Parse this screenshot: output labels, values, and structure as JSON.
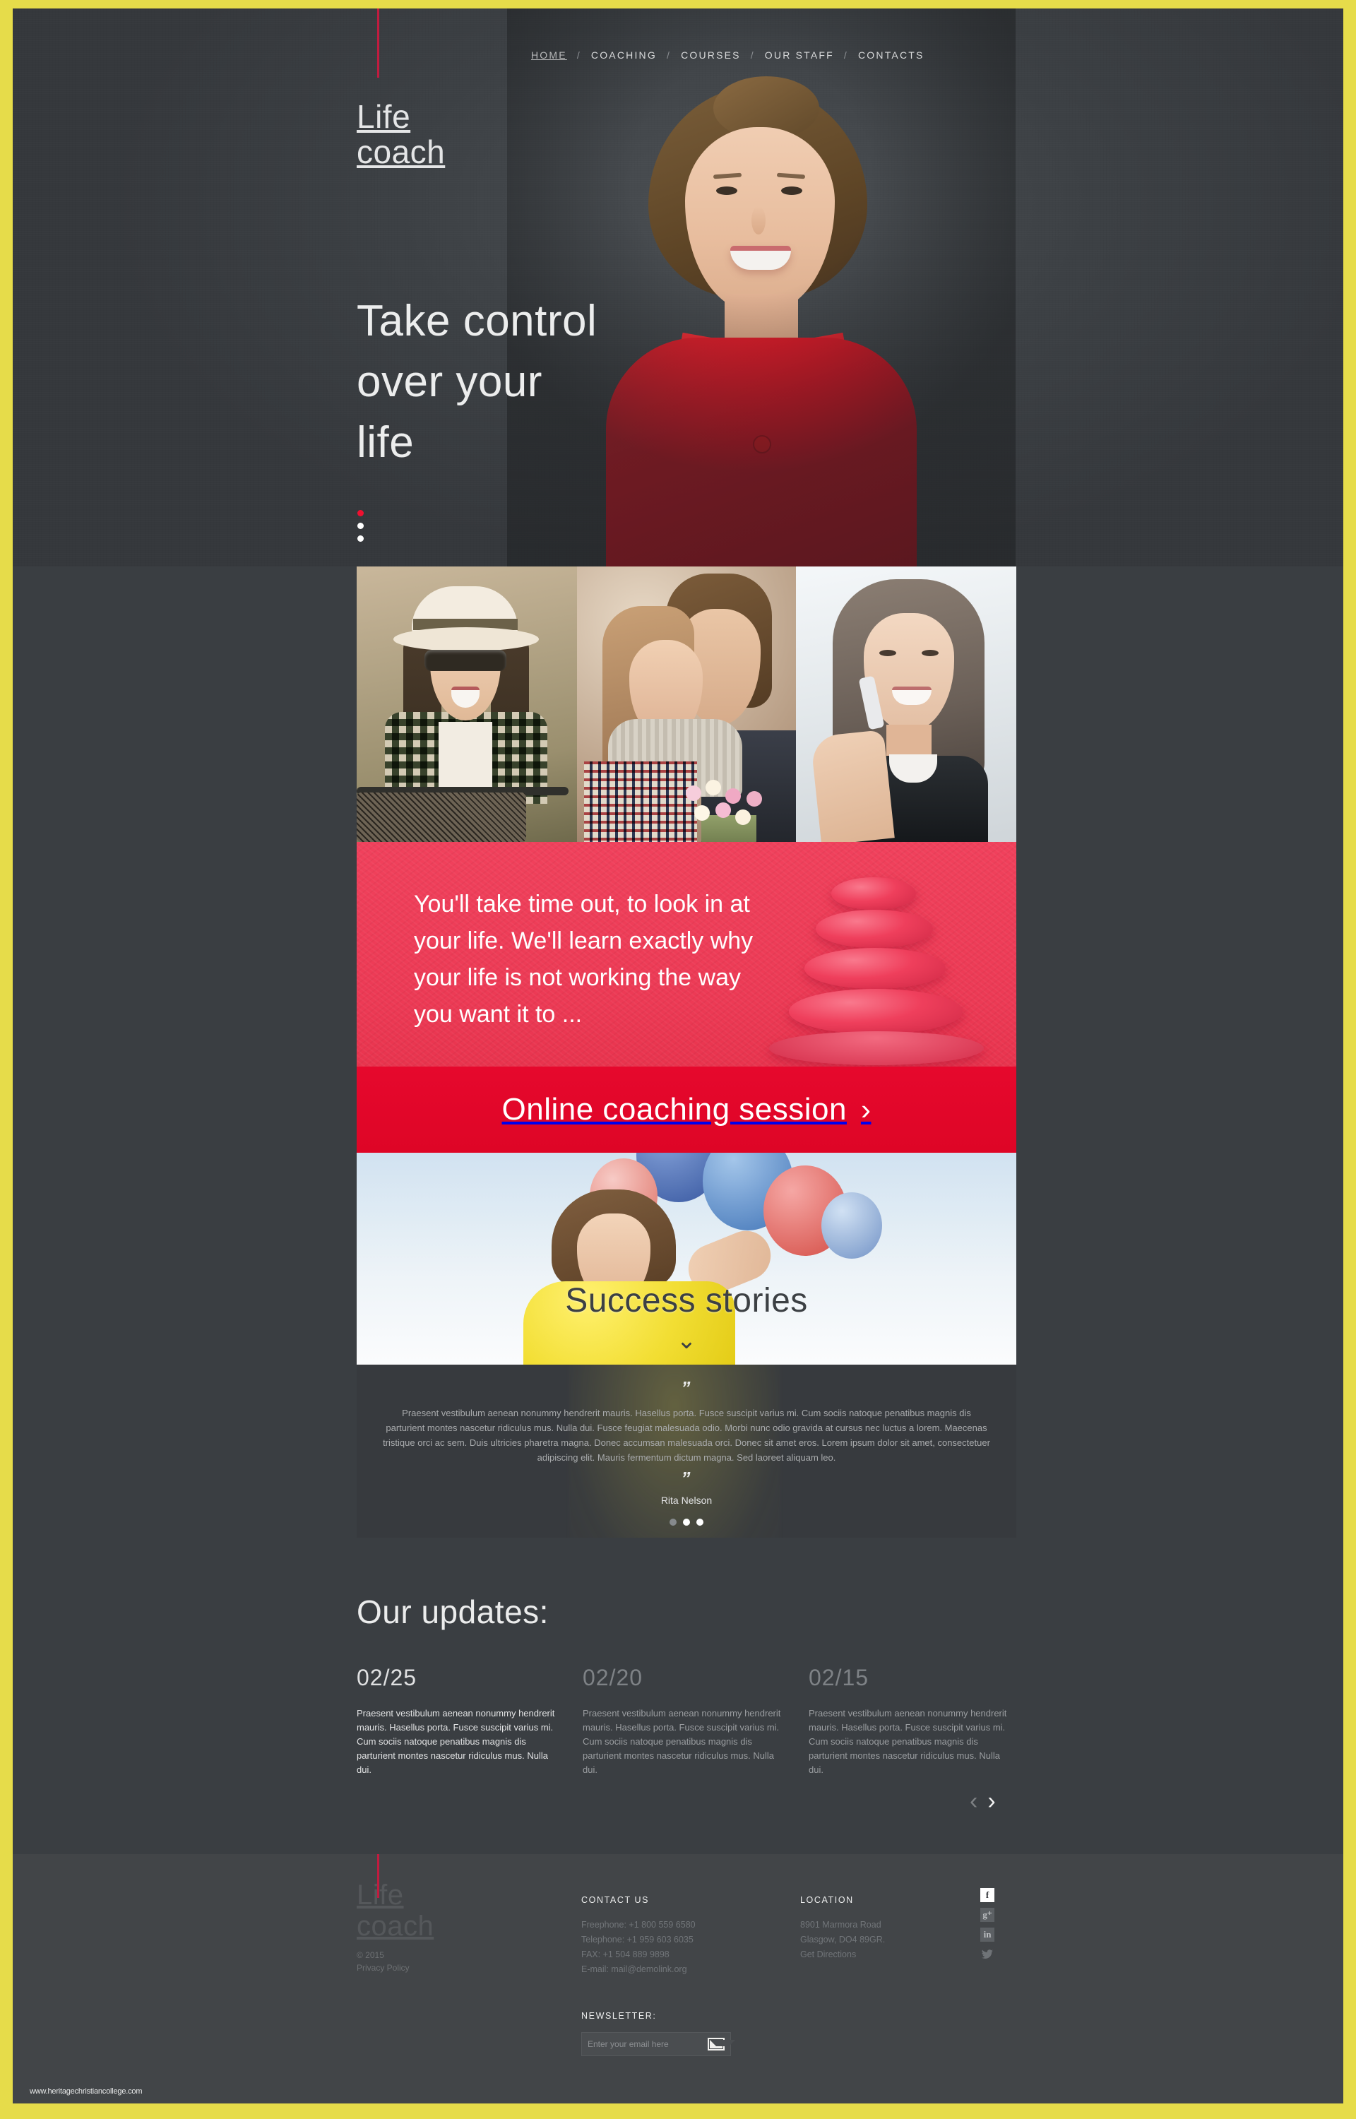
{
  "brand": {
    "line1": "Life",
    "line2": "coach",
    "accent_color": "#c01c3f"
  },
  "nav": {
    "items": [
      {
        "label": "HOME",
        "active": true
      },
      {
        "label": "COACHING",
        "active": false
      },
      {
        "label": "COURSES",
        "active": false
      },
      {
        "label": "OUR STAFF",
        "active": false
      },
      {
        "label": "CONTACTS",
        "active": false
      }
    ],
    "separator": "/"
  },
  "hero": {
    "title_line1": "Take control",
    "title_line2": "over your",
    "title_line3": "life",
    "slider_dots": 3,
    "active_dot": 0
  },
  "quote": {
    "text": "You'll take time out, to look in at your life. We'll learn exactly why your life is not working the way you want it to ...",
    "bg_color": "#ec3a55"
  },
  "cta": {
    "label": "Online coaching session",
    "chevron": "›",
    "bg_color": "#e0062a"
  },
  "stories": {
    "title": "Success stories",
    "chevron_down": "⌄"
  },
  "testimonial": {
    "quote_open": "”",
    "quote_close": "”",
    "body": "Praesent vestibulum aenean nonummy hendrerit mauris. Hasellus porta. Fusce suscipit varius mi. Cum sociis natoque penatibus magnis dis parturient montes nascetur ridiculus mus. Nulla dui. Fusce feugiat malesuada odio. Morbi nunc odio gravida at cursus nec luctus a lorem. Maecenas tristique orci ac sem. Duis ultricies pharetra magna. Donec accumsan malesuada orci. Donec sit amet eros. Lorem ipsum dolor sit amet, consectetuer adipiscing elit. Mauris fermentum dictum magna. Sed laoreet aliquam leo.",
    "author": "Rita Nelson",
    "dots": 3,
    "active_dot": 1
  },
  "updates": {
    "title": "Our updates:",
    "cards": [
      {
        "date": "02/25",
        "text": "Praesent vestibulum aenean nonummy hendrerit mauris. Hasellus porta. Fusce suscipit varius mi. Cum sociis natoque penatibus magnis dis parturient montes nascetur ridiculus mus. Nulla dui.",
        "highlight": true
      },
      {
        "date": "02/20",
        "text": "Praesent vestibulum aenean nonummy hendrerit mauris. Hasellus porta. Fusce suscipit varius mi. Cum sociis natoque penatibus magnis dis parturient montes nascetur ridiculus mus. Nulla dui.",
        "highlight": false
      },
      {
        "date": "02/15",
        "text": "Praesent vestibulum aenean nonummy hendrerit mauris. Hasellus porta. Fusce suscipit varius mi. Cum sociis natoque penatibus magnis dis parturient montes nascetur ridiculus mus. Nulla dui.",
        "highlight": false
      }
    ],
    "prev_arrow": "‹",
    "next_arrow": "›"
  },
  "footer": {
    "copyright": "© 2015",
    "privacy": "Privacy Policy",
    "contact": {
      "heading": "CONTACT US",
      "freephone": "Freephone: +1 800 559 6580",
      "telephone": "Telephone: +1 959 603 6035",
      "fax": "FAX: +1 504 889 9898",
      "email": "E-mail: mail@demolink.org"
    },
    "location": {
      "heading": "LOCATION",
      "address_line1": "8901 Marmora Road",
      "address_line2": "Glasgow, DO4 89GR.",
      "directions": "Get Directions"
    },
    "newsletter": {
      "heading": "NEWSLETTER:",
      "placeholder": "Enter your email here",
      "value": ""
    },
    "socials": [
      {
        "name": "facebook",
        "glyph": "f"
      },
      {
        "name": "google-plus",
        "glyph": "g⁺"
      },
      {
        "name": "linkedin",
        "glyph": "in"
      },
      {
        "name": "twitter",
        "glyph": "ᴠ"
      }
    ]
  },
  "watermark": "www.heritagechristiancollege.com"
}
